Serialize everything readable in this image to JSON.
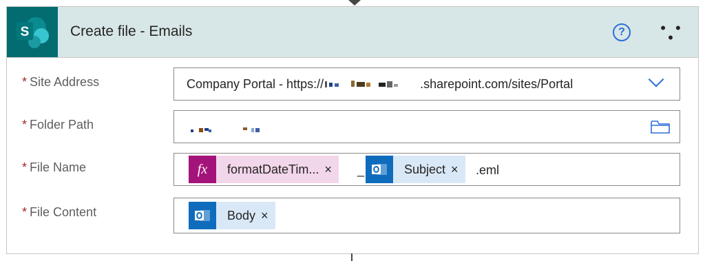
{
  "action": {
    "title": "Create file - Emails",
    "help_icon": "help-icon",
    "more_icon": "more-options-icon",
    "help_glyph": "?",
    "more_glyph": "• • •"
  },
  "required_marker": "*",
  "fields": {
    "site_address": {
      "label": "Site Address",
      "value_prefix": "Company Portal - https://",
      "value_suffix": ".sharepoint.com/sites/Portal"
    },
    "folder_path": {
      "label": "Folder Path"
    },
    "file_name": {
      "label": "File Name",
      "token1": "formatDateTim...",
      "separator": "_",
      "token2": "Subject",
      "suffix": ".eml"
    },
    "file_content": {
      "label": "File Content",
      "token1": "Body"
    }
  },
  "token_remove": "×",
  "expression_glyph": "fx",
  "colors": {
    "header_bg": "#d7e6e7",
    "sharepoint_teal": "#036c70",
    "expression_purple": "#a4137a",
    "expression_token_bg": "#f2d6ea",
    "outlook_blue": "#0f6cbd",
    "outlook_token_bg": "#d9e8f7",
    "accent_blue": "#2a6ed8",
    "required_red": "#a4262c"
  }
}
